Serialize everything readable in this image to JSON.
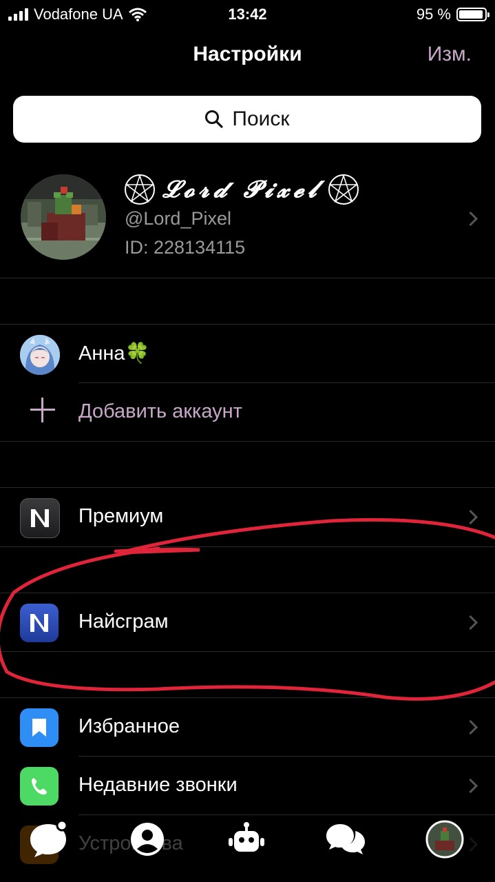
{
  "status_bar": {
    "carrier": "Vodafone UA",
    "time": "13:42",
    "battery": "95 %",
    "battery_level": 0.95
  },
  "header": {
    "title": "Настройки",
    "edit_label": "Изм."
  },
  "search": {
    "label": "Поиск"
  },
  "profile": {
    "display_name": "𝓛𝓸𝓻𝓭 𝓟𝓲𝔁𝓮𝓵",
    "username": "@Lord_Pixel",
    "user_id": "ID: 228134115"
  },
  "accounts": [
    {
      "name": "Анна🍀"
    }
  ],
  "add_account_label": "Добавить аккаунт",
  "menu": {
    "premium": "Премиум",
    "nicegram": "Найсграм",
    "favorites": "Избранное",
    "recent_calls": "Недавние звонки",
    "devices": "Устройства"
  },
  "colors": {
    "accent": "#c8a8c8",
    "background": "#000000",
    "annotation": "#e0243a"
  }
}
